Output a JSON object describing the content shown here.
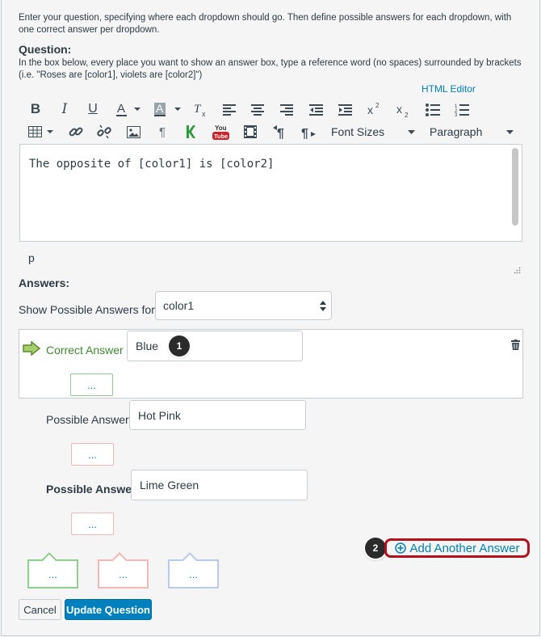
{
  "intro_text": "Enter your question, specifying where each dropdown should go. Then define possible answers for each dropdown, with one correct answer per dropdown.",
  "question": {
    "title": "Question:",
    "help": "In the box below, every place you want to show an answer box, type a reference word (no spaces) surrounded by brackets (i.e. \"Roses are [color1], violets are [color2]\")",
    "html_editor_label": "HTML Editor",
    "font_sizes_label": "Font Sizes",
    "paragraph_label": "Paragraph",
    "youtube_label": "You Tube",
    "content": "The opposite of [color1] is [color2]",
    "path": "p"
  },
  "answers": {
    "title": "Answers:",
    "show_label": "Show Possible Answers for",
    "selected_blank": "color1",
    "correct_label": "Correct Answer",
    "correct_value": "Blue",
    "possible_label": "Possible Answer",
    "possible_values": [
      "Hot Pink",
      "Lime Green"
    ],
    "dots": "...",
    "add_label": "Add Another Answer"
  },
  "callouts": [
    "1",
    "2"
  ],
  "buttons": {
    "cancel": "Cancel",
    "update": "Update Question"
  },
  "colors": {
    "link": "#0081bd",
    "correct_green": "#3d8a2e",
    "callout_border": "#b3121d",
    "primary": "#0081bd"
  }
}
